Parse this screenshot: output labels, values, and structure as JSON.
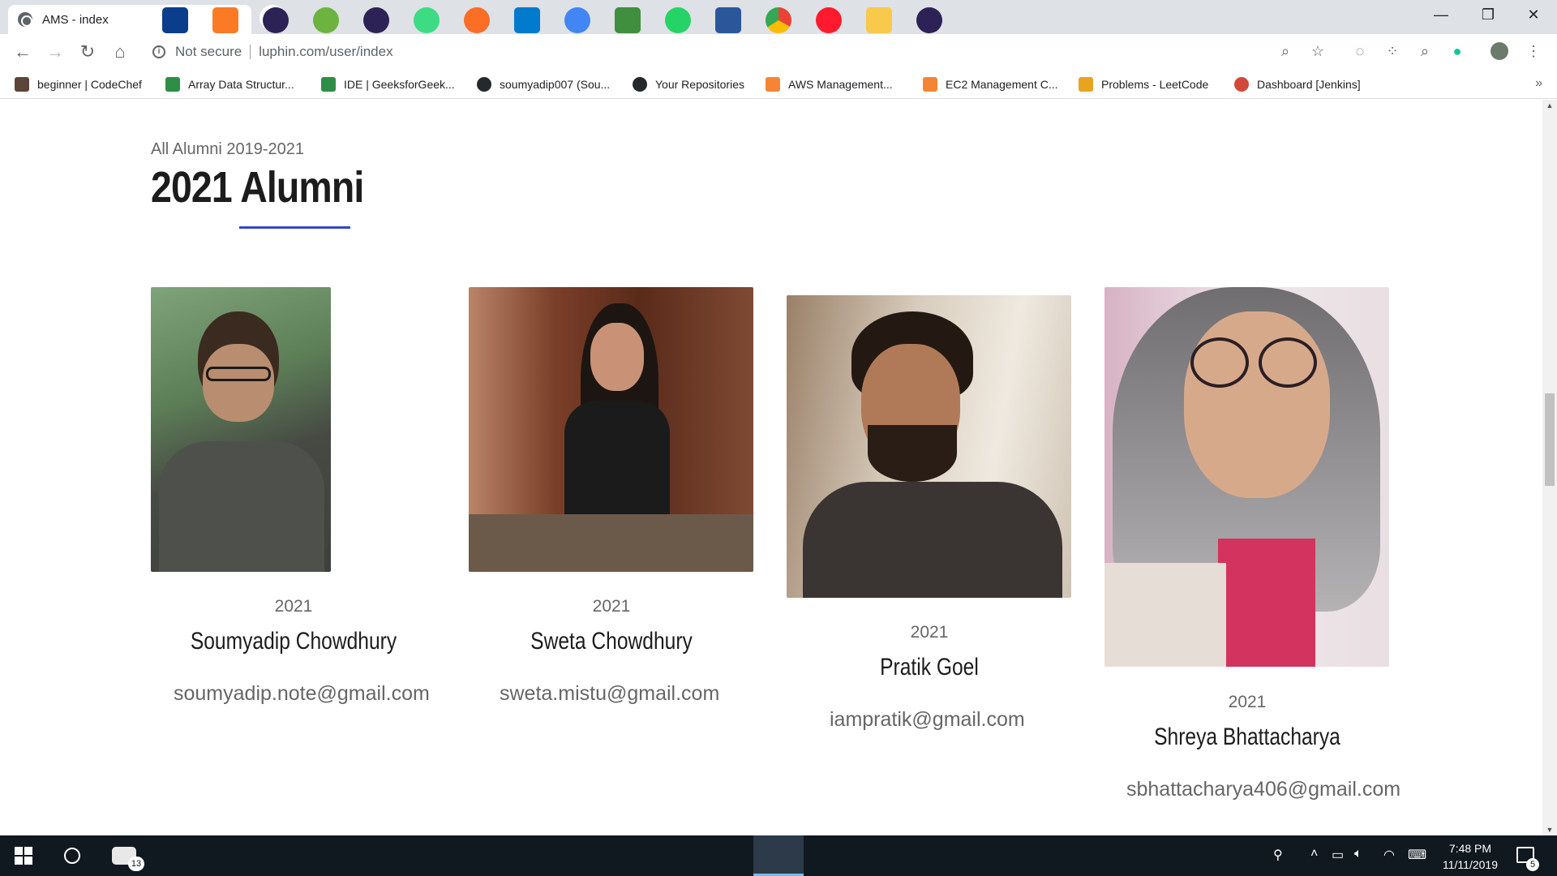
{
  "browser": {
    "tab_title": "AMS - index",
    "tab_close": "×",
    "new_tab": "+",
    "window_controls": [
      "—",
      "❐",
      "✕"
    ],
    "security_label": "Not secure",
    "url": "luphin.com/user/index",
    "bookmarks": [
      {
        "label": "beginner | CodeChef",
        "icon": "codechef-icon",
        "color": "#5b4638"
      },
      {
        "label": "Array Data Structur...",
        "icon": "geeksforgeeks-icon",
        "color": "#2f8d46"
      },
      {
        "label": "IDE | GeeksforGeek...",
        "icon": "geeksforgeeks-icon",
        "color": "#2f8d46"
      },
      {
        "label": "soumyadip007 (Sou...",
        "icon": "github-icon",
        "color": "#24292e"
      },
      {
        "label": "Your Repositories",
        "icon": "github-icon",
        "color": "#24292e"
      },
      {
        "label": "AWS Management...",
        "icon": "aws-icon",
        "color": "#f58534"
      },
      {
        "label": "EC2 Management C...",
        "icon": "aws-icon",
        "color": "#f58534"
      },
      {
        "label": "Problems - LeetCode",
        "icon": "leetcode-icon",
        "color": "#e7a41f"
      },
      {
        "label": "Dashboard [Jenkins]",
        "icon": "jenkins-icon",
        "color": "#d24939"
      }
    ],
    "bookmarks_more": "»"
  },
  "page": {
    "subheading": "All Alumni 2019-2021",
    "heading": "2021 Alumni",
    "accent_color": "#3346c9",
    "alumni": [
      {
        "year": "2021",
        "name": "Soumyadip Chowdhury",
        "email": "soumyadip.note@gmail.com"
      },
      {
        "year": "2021",
        "name": "Sweta Chowdhury",
        "email": "sweta.mistu@gmail.com"
      },
      {
        "year": "2021",
        "name": "Pratik Goel",
        "email": "iampratik@gmail.com"
      },
      {
        "year": "2021",
        "name": "Shreya Bhattacharya",
        "email": "sbhattacharya406@gmail.com"
      }
    ]
  },
  "taskbar": {
    "time": "7:48 PM",
    "date": "11/11/2019",
    "mail_badge": "13",
    "notification_badge": "5"
  }
}
